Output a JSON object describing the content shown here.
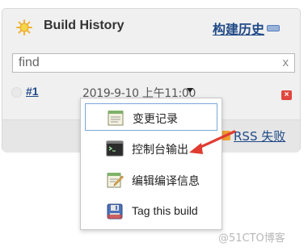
{
  "panel": {
    "title": "Build History",
    "title_link": "构建历史"
  },
  "filter": {
    "value": "find",
    "clear_glyph": "x"
  },
  "build": {
    "number": "#1",
    "date": "2019-9-10 上午11:00"
  },
  "footer": {
    "rss_label": "RSS 失败"
  },
  "menu": {
    "items": [
      {
        "label": "变更记录",
        "icon": "notepad-icon"
      },
      {
        "label": "控制台输出",
        "icon": "terminal-icon"
      },
      {
        "label": "编辑编译信息",
        "icon": "edit-notepad-icon"
      },
      {
        "label": "Tag this build",
        "icon": "save-disk-icon"
      }
    ],
    "selected_index": 0
  },
  "watermark": "@51CTO博客",
  "colors": {
    "link": "#204a87",
    "annotation_arrow": "#e03c31",
    "selection_border": "#7aa7d8"
  }
}
